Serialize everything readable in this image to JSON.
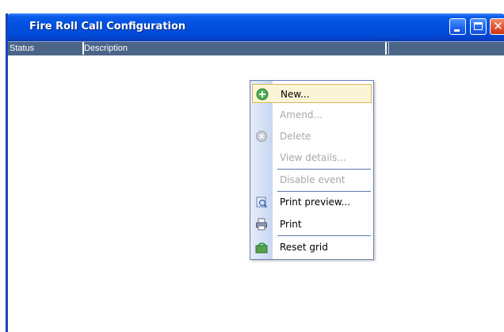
{
  "window": {
    "title": "Fire Roll Call Configuration"
  },
  "grid": {
    "columns": [
      "Status",
      "Description",
      ""
    ]
  },
  "context_menu": {
    "items": [
      {
        "label": "New...",
        "icon": "add-icon",
        "enabled": true,
        "hover": true
      },
      {
        "label": "Amend...",
        "icon": "",
        "enabled": false
      },
      {
        "label": "Delete",
        "icon": "delete-icon",
        "enabled": false
      },
      {
        "label": "View details...",
        "icon": "",
        "enabled": false
      },
      {
        "label": "Disable event",
        "icon": "",
        "enabled": false
      },
      {
        "label": "Print preview...",
        "icon": "print-preview-icon",
        "enabled": true
      },
      {
        "label": "Print",
        "icon": "printer-icon",
        "enabled": true
      },
      {
        "label": "Reset grid",
        "icon": "reset-grid-icon",
        "enabled": true
      }
    ]
  },
  "colors": {
    "titlebar": "#0050e0",
    "header": "#4a6588",
    "menu_border": "#6a7fb0",
    "hover": "#fcf4d6"
  }
}
